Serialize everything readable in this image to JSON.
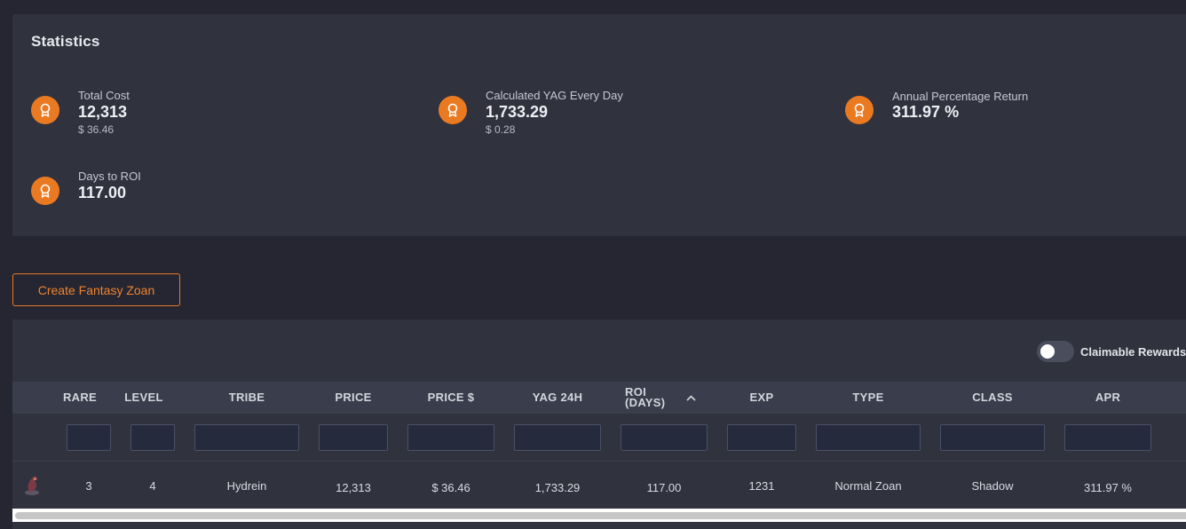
{
  "statistics": {
    "title": "Statistics",
    "items": [
      {
        "label": "Total Cost",
        "value": "12,313",
        "sub": "$ 36.46",
        "icon": "award-icon"
      },
      {
        "label": "Calculated YAG Every Day",
        "value": "1,733.29",
        "sub": "$ 0.28",
        "icon": "award-icon"
      },
      {
        "label": "Annual Percentage Return",
        "value": "311.97 %",
        "sub": "",
        "icon": "award-icon"
      },
      {
        "label": "Days to ROI",
        "value": "117.00",
        "sub": "",
        "icon": "award-icon"
      }
    ]
  },
  "actions": {
    "create_label": "Create Fantasy Zoan"
  },
  "table": {
    "toggle_label": "Claimable Rewards",
    "toggle_on": false,
    "columns": [
      "RARE",
      "LEVEL",
      "TRIBE",
      "PRICE",
      "PRICE $",
      "YAG 24H",
      "ROI (DAYS)",
      "EXP",
      "TYPE",
      "CLASS",
      "APR"
    ],
    "sorted_column": "ROI (DAYS)",
    "sort_direction": "ascending",
    "rows": [
      {
        "rare": "3",
        "level": "4",
        "tribe": "Hydrein",
        "price": "12,313",
        "price_usd": "$ 36.46",
        "yag_24h": "1,733.29",
        "roi_days": "117.00",
        "exp": "1231",
        "type": "Normal Zoan",
        "class": "Shadow",
        "apr": "311.97 %"
      }
    ]
  },
  "colors": {
    "accent": "#ea7a22",
    "background": "#252631",
    "card": "#30323e",
    "header": "#3a3d4b"
  }
}
